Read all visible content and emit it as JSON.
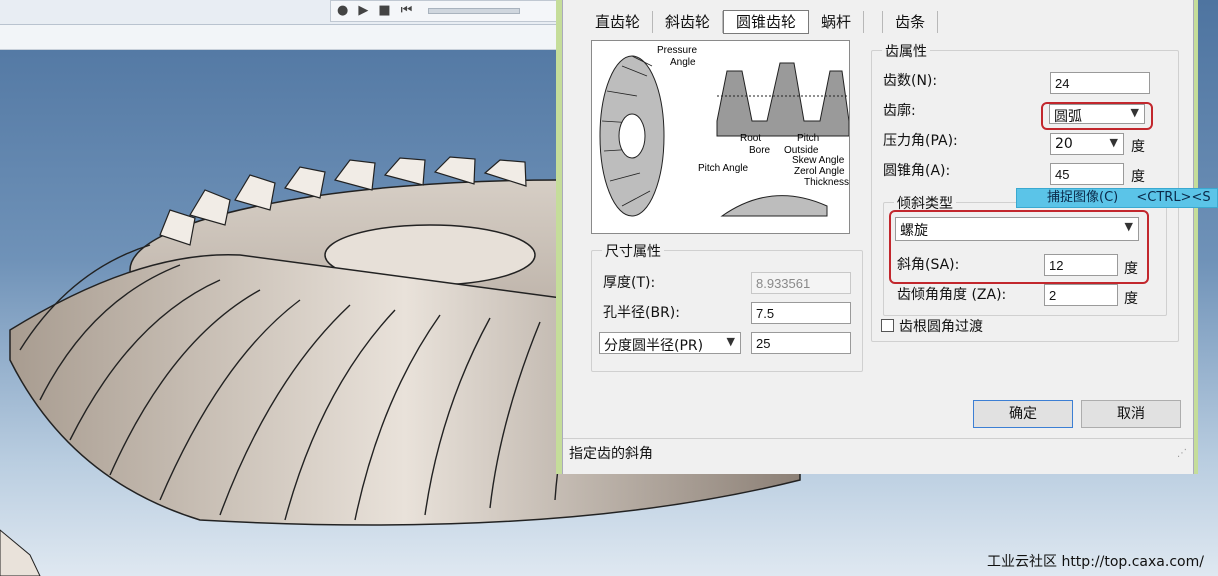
{
  "toolbar": {
    "icons": [
      "record-icon",
      "play-icon",
      "stop-icon",
      "rewind-icon"
    ]
  },
  "tabs": [
    "直齿轮",
    "斜齿轮",
    "圆锥齿轮",
    "蜗杆",
    "齿条"
  ],
  "active_tab": "圆锥齿轮",
  "diagram": {
    "labels": [
      "Pressure",
      "Angle",
      "Root",
      "Pitch",
      "Bore",
      "Outside",
      "Pitch Angle",
      "Skew Angle",
      "Zerol Angle",
      "Thickness"
    ]
  },
  "gear_props": {
    "title": "齿属性",
    "teeth": {
      "label": "齿数(N):",
      "value": "24"
    },
    "profile": {
      "label": "齿廓:",
      "value": "圆弧"
    },
    "pressure_angle": {
      "label": "压力角(PA):",
      "value": "20",
      "unit": "度"
    },
    "cone_angle": {
      "label": "圆锥角(A):",
      "value": "45",
      "unit": "度"
    }
  },
  "skew": {
    "title": "倾斜类型",
    "type_value": "螺旋",
    "skew_angle": {
      "label": "斜角(SA):",
      "value": "12",
      "unit": "度"
    },
    "tooth_tilt": {
      "label": "齿倾角角度 (ZA):",
      "value": "2",
      "unit": "度"
    }
  },
  "root_fillet": {
    "label": "齿根圆角过渡",
    "checked": false
  },
  "size_props": {
    "title": "尺寸属性",
    "thickness": {
      "label": "厚度(T):",
      "value": "8.933561"
    },
    "bore_radius": {
      "label": "孔半径(BR):",
      "value": "7.5"
    },
    "pitch_radius": {
      "select": "分度圆半径(PR)",
      "value": "25"
    }
  },
  "buttons": {
    "ok": "确定",
    "cancel": "取消"
  },
  "status_text": "指定齿的斜角",
  "tooltip": {
    "text": "捕捉图像(C)",
    "shortcut": "<CTRL><S"
  },
  "watermark": "工业云社区 http://top.caxa.com/",
  "colors": {
    "dialog_frame": "#c5dd9a",
    "highlight": "#c2272d",
    "tooltip": "#5bc4e8"
  }
}
